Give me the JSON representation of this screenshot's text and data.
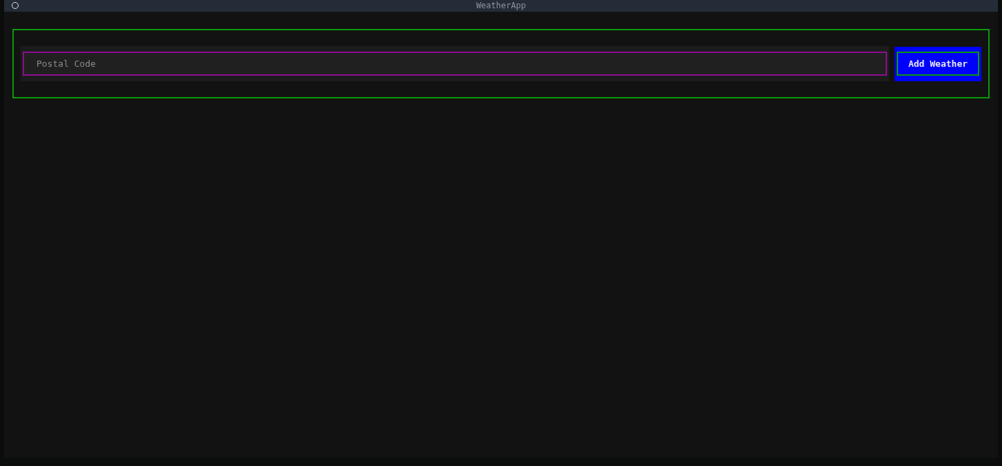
{
  "window": {
    "title": "WeatherApp"
  },
  "form": {
    "postal_code": {
      "placeholder": "Postal Code"
    },
    "add_button": {
      "label": "Add Weather"
    }
  }
}
